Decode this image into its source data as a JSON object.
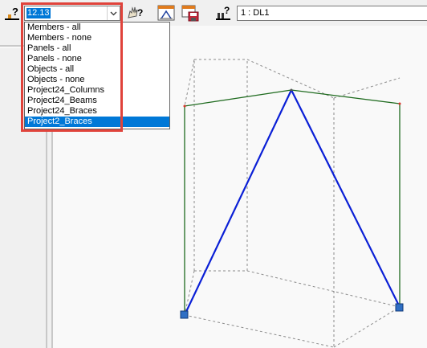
{
  "toolbar": {
    "selection_value": "12.13",
    "load_case_value": "1 : DL1"
  },
  "selection_list": {
    "items": [
      "Members - all",
      "Members - none",
      "Panels - all",
      "Panels - none",
      "Objects - all",
      "Objects - none",
      "Project24_Columns",
      "Project24_Beams",
      "Project24_Braces",
      "Project2_Braces"
    ],
    "selected_index": 9
  },
  "icons": [
    "selection-help-icon",
    "dropdown-arrow-icon",
    "hand-help-icon",
    "structure-view-icon",
    "save-view-icon",
    "load-case-help-icon"
  ],
  "colors": {
    "highlight": "#e0433b",
    "selected": "#0078d7",
    "brace": "#0a1fd6",
    "beam": "#1f6b1f",
    "support": "#2f6fc4"
  }
}
